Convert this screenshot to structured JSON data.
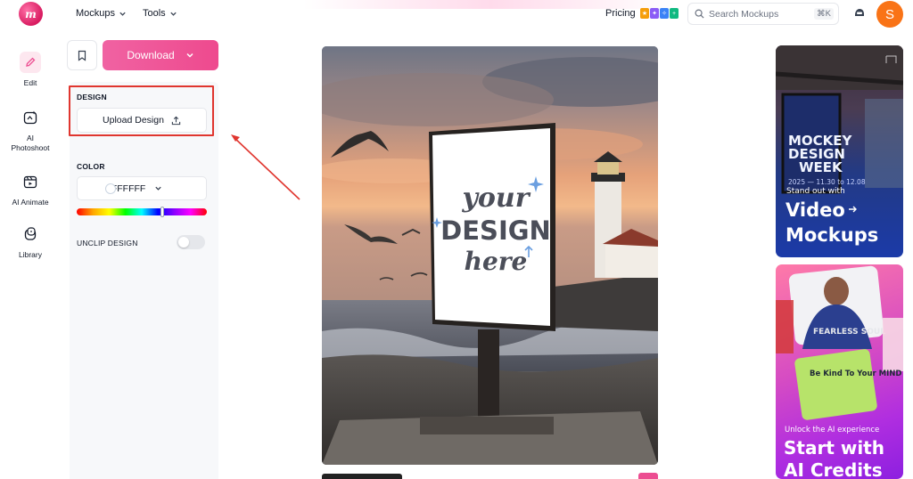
{
  "app": {
    "logo_glyph": "m"
  },
  "header": {
    "nav": [
      {
        "label": "Mockups"
      },
      {
        "label": "Tools"
      }
    ],
    "pricing_label": "Pricing",
    "search": {
      "placeholder": "Search Mockups",
      "shortcut": "⌘K"
    },
    "avatar_initial": "S"
  },
  "rail": {
    "items": [
      {
        "label": "Edit",
        "icon": "pencil-icon",
        "active": true
      },
      {
        "label": "AI Photoshoot",
        "icon": "ai-photoshoot-icon"
      },
      {
        "label": "AI Animate",
        "icon": "ai-animate-icon"
      },
      {
        "label": "Library",
        "icon": "library-icon"
      }
    ]
  },
  "panel": {
    "download_label": "Download",
    "design_section": "DESIGN",
    "upload_label": "Upload Design",
    "color_section": "COLOR",
    "color_value": "#FFFFFF",
    "unclip_label": "UNCLIP DESIGN",
    "unclip_enabled": false,
    "hue_position": 0.66
  },
  "mockup": {
    "billboard_text": {
      "line1": "your",
      "line2": "DESIGN",
      "line3": "here"
    }
  },
  "ads": [
    {
      "poster_line1": "MOCKEY",
      "poster_line2": "DESIGN",
      "poster_line3": "WEEK",
      "dates": "2025 — 11.30 to 12.08",
      "tagline": "Stand out with",
      "headline1": "Video",
      "headline2": "Mockups"
    },
    {
      "hoodie_text": "FEARLESS SOUL",
      "shirt_text": "Be Kind To Your MIND",
      "tagline": "Unlock the AI experience",
      "headline1": "Start with",
      "headline2": "AI Credits"
    }
  ],
  "colors": {
    "accent": "#ee4a8e",
    "avatar": "#f97316",
    "annotation": "#e0362f"
  }
}
